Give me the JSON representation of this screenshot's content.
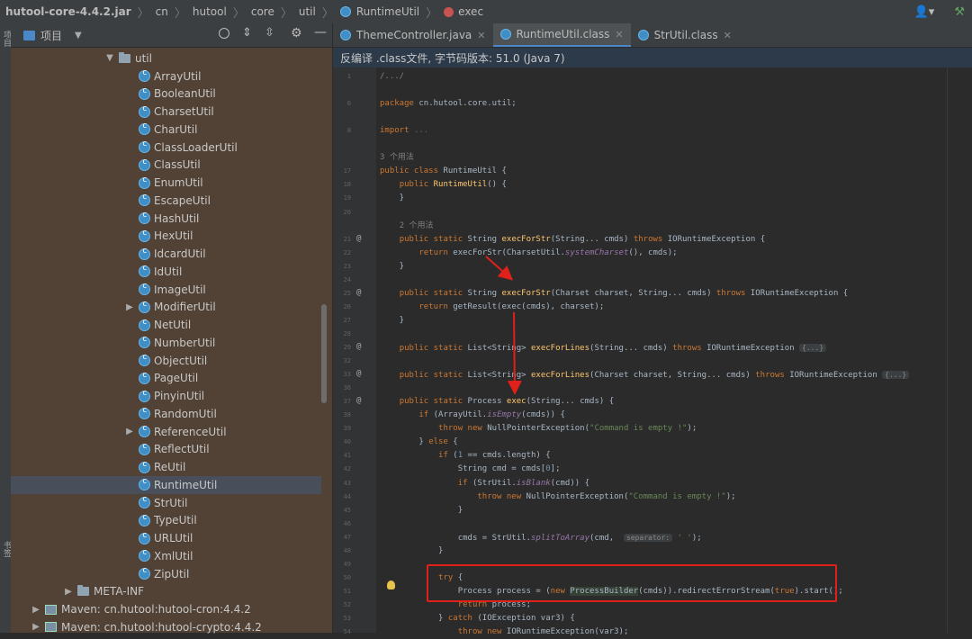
{
  "breadcrumb": {
    "items": [
      {
        "label": "hutool-core-4.4.2.jar",
        "icon": ""
      },
      {
        "label": "cn",
        "icon": ""
      },
      {
        "label": "hutool",
        "icon": ""
      },
      {
        "label": "core",
        "icon": ""
      },
      {
        "label": "util",
        "icon": ""
      },
      {
        "label": "RuntimeUtil",
        "icon": "class-icon"
      },
      {
        "label": "exec",
        "icon": "method-icon"
      }
    ]
  },
  "left_strip": {
    "top_label": "项目",
    "bottom_label": "书签"
  },
  "project_panel": {
    "title": "项目",
    "tree": [
      {
        "label": "util",
        "kind": "folder",
        "indent": 1,
        "expanded": true
      },
      {
        "label": "ArrayUtil",
        "kind": "class",
        "indent": 2
      },
      {
        "label": "BooleanUtil",
        "kind": "class",
        "indent": 2
      },
      {
        "label": "CharsetUtil",
        "kind": "class",
        "indent": 2
      },
      {
        "label": "CharUtil",
        "kind": "class",
        "indent": 2
      },
      {
        "label": "ClassLoaderUtil",
        "kind": "class",
        "indent": 2
      },
      {
        "label": "ClassUtil",
        "kind": "class",
        "indent": 2
      },
      {
        "label": "EnumUtil",
        "kind": "class",
        "indent": 2
      },
      {
        "label": "EscapeUtil",
        "kind": "class",
        "indent": 2
      },
      {
        "label": "HashUtil",
        "kind": "class",
        "indent": 2
      },
      {
        "label": "HexUtil",
        "kind": "class",
        "indent": 2
      },
      {
        "label": "IdcardUtil",
        "kind": "class",
        "indent": 2
      },
      {
        "label": "IdUtil",
        "kind": "class",
        "indent": 2
      },
      {
        "label": "ImageUtil",
        "kind": "class",
        "indent": 2
      },
      {
        "label": "ModifierUtil",
        "kind": "class",
        "indent": 2,
        "expander": true
      },
      {
        "label": "NetUtil",
        "kind": "class",
        "indent": 2
      },
      {
        "label": "NumberUtil",
        "kind": "class",
        "indent": 2
      },
      {
        "label": "ObjectUtil",
        "kind": "class",
        "indent": 2
      },
      {
        "label": "PageUtil",
        "kind": "class",
        "indent": 2
      },
      {
        "label": "PinyinUtil",
        "kind": "class",
        "indent": 2
      },
      {
        "label": "RandomUtil",
        "kind": "class",
        "indent": 2
      },
      {
        "label": "ReferenceUtil",
        "kind": "class",
        "indent": 2,
        "expander": true
      },
      {
        "label": "ReflectUtil",
        "kind": "class",
        "indent": 2
      },
      {
        "label": "ReUtil",
        "kind": "class",
        "indent": 2
      },
      {
        "label": "RuntimeUtil",
        "kind": "class",
        "indent": 2,
        "selected": true
      },
      {
        "label": "StrUtil",
        "kind": "class",
        "indent": 2
      },
      {
        "label": "TypeUtil",
        "kind": "class",
        "indent": 2
      },
      {
        "label": "URLUtil",
        "kind": "class",
        "indent": 2
      },
      {
        "label": "XmlUtil",
        "kind": "class",
        "indent": 2
      },
      {
        "label": "ZipUtil",
        "kind": "class",
        "indent": 2
      },
      {
        "label": "META-INF",
        "kind": "folder",
        "indent": 0,
        "expander": true
      },
      {
        "label": "Maven: cn.hutool:hutool-cron:4.4.2",
        "kind": "maven",
        "indent": -1,
        "expander": true
      },
      {
        "label": "Maven: cn.hutool:hutool-crypto:4.4.2",
        "kind": "maven",
        "indent": -1,
        "expander": true
      }
    ]
  },
  "editor": {
    "tabs": [
      {
        "label": "ThemeController.java",
        "active": false
      },
      {
        "label": "RuntimeUtil.class",
        "active": true
      },
      {
        "label": "StrUtil.class",
        "active": false
      }
    ],
    "banner": "反编译 .class文件, 字节码版本: 51.0 (Java 7)",
    "lines": [
      {
        "n": "1",
        "html": "<span class='cm'>/.../</span>"
      },
      {
        "n": "",
        "html": ""
      },
      {
        "n": "6",
        "html": "<span class='kw'>package</span> cn.hutool.core.util;"
      },
      {
        "n": "",
        "html": ""
      },
      {
        "n": "8",
        "html": "<span class='kw'>import</span> <span class='gy'>...</span>"
      },
      {
        "n": "",
        "html": ""
      },
      {
        "n": "",
        "html": "<span class='cm'>3 个用法</span>"
      },
      {
        "n": "17",
        "html": "<span class='kw'>public class</span> RuntimeUtil {"
      },
      {
        "n": "18",
        "html": "    <span class='kw'>public</span> <span class='fn'>RuntimeUtil</span>() {"
      },
      {
        "n": "19",
        "html": "    }"
      },
      {
        "n": "20",
        "html": ""
      },
      {
        "n": "",
        "html": "    <span class='cm'>2 个用法</span>"
      },
      {
        "n": "21",
        "html": "    <span class='kw'>public static</span> String <span class='fn'>execForStr</span>(String... cmds) <span class='kw'>throws</span> IORuntimeException {"
      },
      {
        "n": "22",
        "html": "        <span class='kw'>return</span> execForStr(CharsetUtil.<span class='sf'>systemCharset</span>(), cmds);"
      },
      {
        "n": "23",
        "html": "    }"
      },
      {
        "n": "24",
        "html": ""
      },
      {
        "n": "25",
        "html": "    <span class='kw'>public static</span> String <span class='fn'>execForStr</span>(Charset charset, String... cmds) <span class='kw'>throws</span> IORuntimeException {"
      },
      {
        "n": "26",
        "html": "        <span class='kw'>return</span> getResult(exec(cmds), charset);"
      },
      {
        "n": "27",
        "html": "    }"
      },
      {
        "n": "28",
        "html": ""
      },
      {
        "n": "29",
        "html": "    <span class='kw'>public static</span> List&lt;String&gt; <span class='fn'>execForLines</span>(String... cmds) <span class='kw'>throws</span> IORuntimeException <span class='hint'>{...}</span>"
      },
      {
        "n": "32",
        "html": ""
      },
      {
        "n": "33",
        "html": "    <span class='kw'>public static</span> List&lt;String&gt; <span class='fn'>execForLines</span>(Charset charset, String... cmds) <span class='kw'>throws</span> IORuntimeException <span class='hint'>{...}</span>"
      },
      {
        "n": "36",
        "html": ""
      },
      {
        "n": "37",
        "html": "    <span class='kw'>public static</span> Process <span class='fn'>exec</span>(String... cmds) {"
      },
      {
        "n": "38",
        "html": "        <span class='kw'>if</span> (ArrayUtil.<span class='sf'>isEmpty</span>(cmds)) {"
      },
      {
        "n": "39",
        "html": "            <span class='kw'>throw new</span> NullPointerException(<span class='st'>\"Command is empty !\"</span>);"
      },
      {
        "n": "40",
        "html": "        } <span class='kw'>else</span> {"
      },
      {
        "n": "41",
        "html": "            <span class='kw'>if</span> (<span class='nu'>1</span> == cmds.length) {"
      },
      {
        "n": "42",
        "html": "                String cmd = cmds[<span class='nu'>0</span>];"
      },
      {
        "n": "43",
        "html": "                <span class='kw'>if</span> (StrUtil.<span class='sf'>isBlank</span>(cmd)) {"
      },
      {
        "n": "44",
        "html": "                    <span class='kw'>throw new</span> NullPointerException(<span class='st'>\"Command is empty !\"</span>);"
      },
      {
        "n": "45",
        "html": "                }"
      },
      {
        "n": "46",
        "html": ""
      },
      {
        "n": "47",
        "html": "                cmds = StrUtil.<span class='sf'>splitToArray</span>(cmd,  <span class='hint'>separator:</span> <span class='st'>' '</span>);"
      },
      {
        "n": "48",
        "html": "            }"
      },
      {
        "n": "49",
        "html": ""
      },
      {
        "n": "50",
        "html": "            <span class='kw'>try</span> {"
      },
      {
        "n": "51",
        "html": "                Process process = (<span class='kw'>new</span> <span style='background:#344134'>ProcessBuilder</span>(cmds)).redirectErrorStream(<span class='kw'>true</span>).start();"
      },
      {
        "n": "52",
        "html": "                <span class='kw'>return</span> process;"
      },
      {
        "n": "53",
        "html": "            } <span class='kw'>catch</span> (IOException var3) {"
      },
      {
        "n": "54",
        "html": "                <span class='kw'>throw new</span> IORuntimeException(var3);"
      }
    ],
    "annotations": [
      "@",
      "@",
      "@",
      "@",
      "@"
    ]
  },
  "colors": {
    "highlight_box": "#e0201a",
    "arrows": "#e0201a",
    "panel_bg": "#524235",
    "editor_bg": "#2b2b2b"
  }
}
